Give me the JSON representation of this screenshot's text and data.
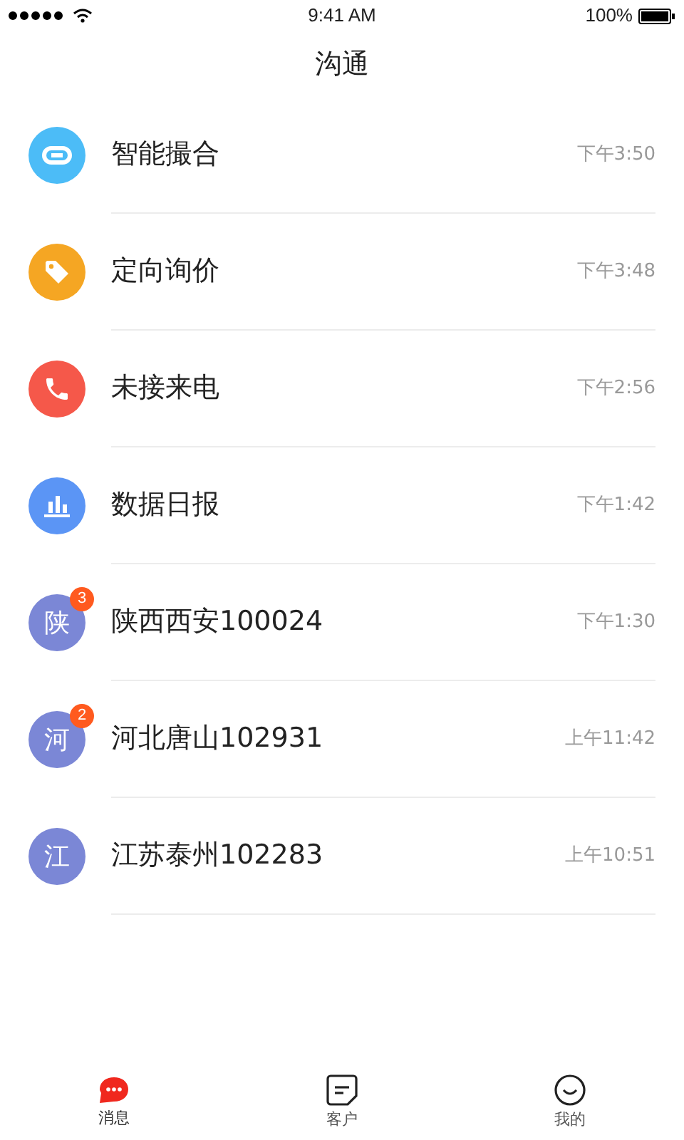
{
  "status_bar": {
    "time": "9:41 AM",
    "battery": "100%"
  },
  "title": "沟通",
  "conversations": [
    {
      "kind": "link",
      "color": "#4cbcf7",
      "name": "智能撮合",
      "time": "下午3:50"
    },
    {
      "kind": "tag",
      "color": "#f5a623",
      "name": "定向询价",
      "time": "下午3:48"
    },
    {
      "kind": "phone",
      "color": "#f5584a",
      "name": "未接来电",
      "time": "下午2:56"
    },
    {
      "kind": "chart",
      "color": "#5b95f5",
      "name": "数据日报",
      "time": "下午1:42"
    },
    {
      "kind": "avatar",
      "color": "#7b87d6",
      "avatar": "陕",
      "badge": "3",
      "name": "陕西西安100024",
      "time": "下午1:30"
    },
    {
      "kind": "avatar",
      "color": "#7b87d6",
      "avatar": "河",
      "badge": "2",
      "name": "河北唐山102931",
      "time": "上午11:42"
    },
    {
      "kind": "avatar",
      "color": "#7b87d6",
      "avatar": "江",
      "name": "江苏泰州102283",
      "time": "上午10:51"
    }
  ],
  "tabs": [
    {
      "kind": "chat",
      "label": "消息",
      "selected": true
    },
    {
      "kind": "note",
      "label": "客户",
      "selected": false
    },
    {
      "kind": "smile",
      "label": "我的",
      "selected": false
    }
  ]
}
